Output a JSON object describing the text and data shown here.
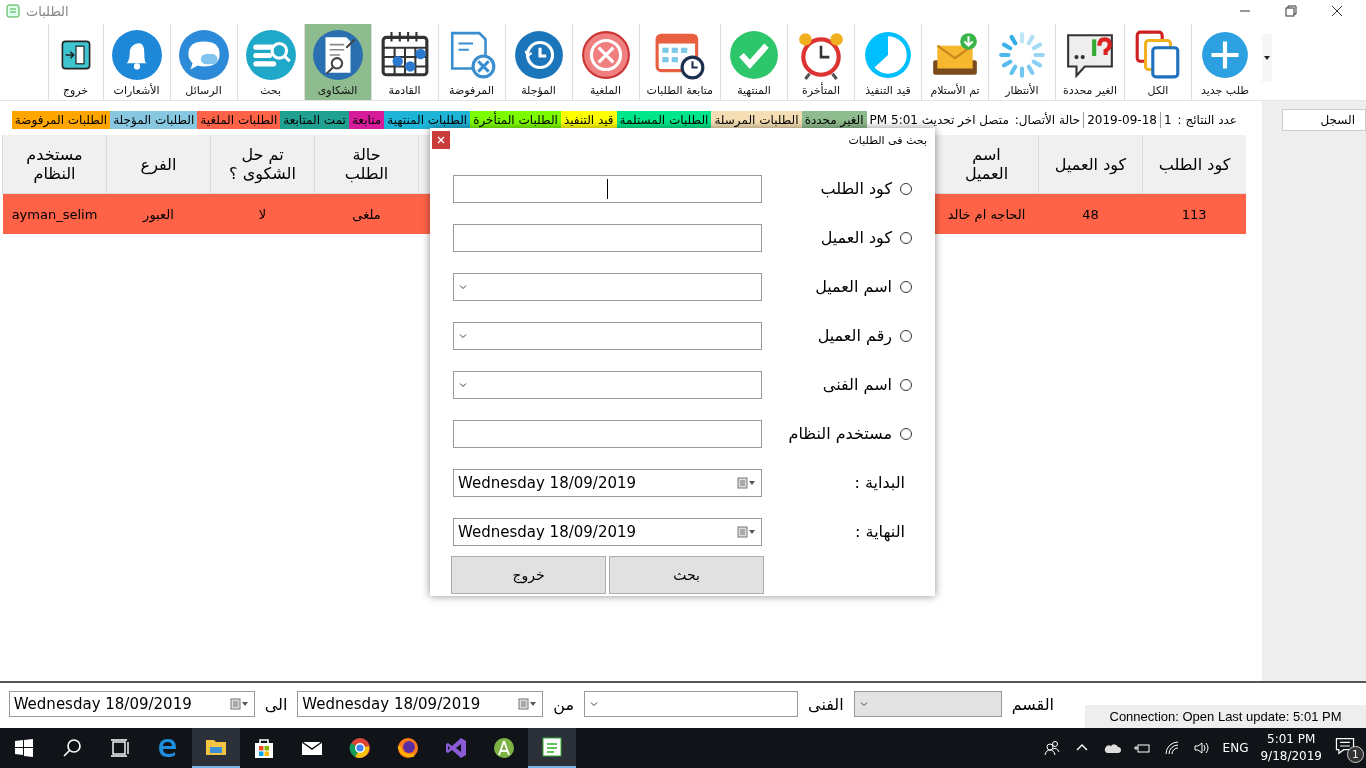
{
  "window": {
    "title": "الطلبات"
  },
  "toolbar": [
    {
      "label": "طلب جديد",
      "selected": false
    },
    {
      "label": "الكل",
      "selected": false
    },
    {
      "label": "الغير محددة",
      "selected": false
    },
    {
      "label": "الأنتظار",
      "selected": false
    },
    {
      "label": "تم الأستلام",
      "selected": false
    },
    {
      "label": "قيد التنفيذ",
      "selected": false
    },
    {
      "label": "المتأخرة",
      "selected": false
    },
    {
      "label": "المنتهية",
      "selected": false
    },
    {
      "label": "متابعة الطلبات",
      "selected": false
    },
    {
      "label": "الملغية",
      "selected": false
    },
    {
      "label": "المؤجلة",
      "selected": false
    },
    {
      "label": "المرفوضة",
      "selected": false
    },
    {
      "label": "القادمة",
      "selected": false
    },
    {
      "label": "الشكاوى",
      "selected": true
    },
    {
      "label": "بحث",
      "selected": false
    },
    {
      "label": "الرسائل",
      "selected": false
    },
    {
      "label": "الأشعارات",
      "selected": false
    },
    {
      "label": "خروج",
      "selected": false
    }
  ],
  "info_bar": {
    "results_label": "عدد النتائج :",
    "results_count": "1",
    "date": "2019-09-18",
    "connection_label": "حالة الأتصال:",
    "connection_text": "متصل اخر تحديث 5:01 PM"
  },
  "legend": [
    {
      "label": "الغير محددة",
      "color": "#8fbc8f"
    },
    {
      "label": "الطلبات المرسلة",
      "color": "#f5deb3"
    },
    {
      "label": "الطلبات المستلمة",
      "color": "#00e68a"
    },
    {
      "label": "قيد التنفيذ",
      "color": "#ffff00"
    },
    {
      "label": "الطلبات المتأخرة",
      "color": "#7cfc00"
    },
    {
      "label": "الطلبات المنتهية",
      "color": "#1eb4d8"
    },
    {
      "label": "متابعة",
      "color": "#d81b9a"
    },
    {
      "label": "تمت المتابعة",
      "color": "#20a090"
    },
    {
      "label": "الطلبات الملغية",
      "color": "#ff6347"
    },
    {
      "label": "الطلبات المؤجلة",
      "color": "#87c8e0"
    },
    {
      "label": "الطلبات المرفوضة",
      "color": "#ffa500"
    }
  ],
  "side_panel": {
    "header": "السجل"
  },
  "table": {
    "columns": [
      "كود الطلب",
      "كود العميل",
      "اسم العميل",
      "حالة الطلب",
      "تم حل الشكوى ؟",
      "الفرع",
      "مستخدم النظام"
    ],
    "rows": [
      {
        "color": "#ff6347",
        "cells": [
          "113",
          "48",
          "الحاجه ام خالد",
          "ملغى",
          "لا",
          "العبور",
          "ayman_selim"
        ]
      }
    ]
  },
  "dialog": {
    "title": "بحث فى الطلبات",
    "fields": [
      {
        "kind": "text",
        "label": "كود الطلب",
        "selected": false
      },
      {
        "kind": "text",
        "label": "كود العميل",
        "selected": false
      },
      {
        "kind": "combo",
        "label": "اسم العميل",
        "selected": false
      },
      {
        "kind": "combo",
        "label": "رقم العميل",
        "selected": false
      },
      {
        "kind": "combo",
        "label": "اسم الفنى",
        "selected": false
      },
      {
        "kind": "text",
        "label": "مستخدم النظام",
        "selected": false
      },
      {
        "kind": "date",
        "label": "البداية :",
        "value": "Wednesday 18/09/2019"
      },
      {
        "kind": "date",
        "label": "النهاية :",
        "value": "Wednesday 18/09/2019"
      }
    ],
    "buttons": [
      "بحث",
      "خروج"
    ]
  },
  "filter_bar": [
    {
      "kind": "label",
      "text": "القسم"
    },
    {
      "kind": "combo",
      "disabled": true
    },
    {
      "kind": "label",
      "text": "الفنى"
    },
    {
      "kind": "combo",
      "disabled": false
    },
    {
      "kind": "label",
      "text": "من"
    },
    {
      "kind": "date",
      "value": "Wednesday 18/09/2019"
    },
    {
      "kind": "label",
      "text": "الى"
    },
    {
      "kind": "date",
      "value": "Wednesday 18/09/2019"
    }
  ],
  "status_bar": {
    "text": "Connection: Open Last update: 5:01 PM"
  },
  "taskbar": {
    "language": "ENG",
    "time": "5:01 PM",
    "date": "9/18/2019",
    "notification_count": "1"
  }
}
